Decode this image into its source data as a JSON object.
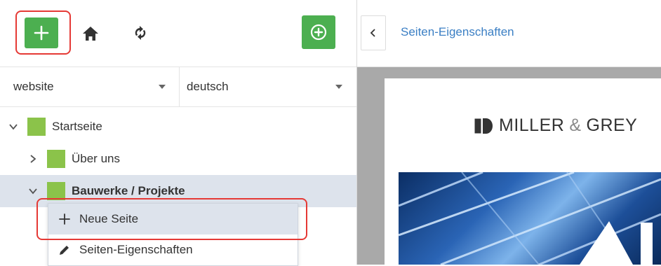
{
  "left_panel": {
    "toolbar": {
      "add_button": {
        "label": "+",
        "icon": "plus-icon"
      },
      "home_icon": "home-icon",
      "refresh_icon": "refresh-icon",
      "add_circle_icon": "plus-circle-icon"
    },
    "selects": {
      "site": "website",
      "language": "deutsch"
    },
    "tree": [
      {
        "label": "Startseite",
        "expanded": true,
        "level": 0
      },
      {
        "label": "Über uns",
        "expanded": false,
        "level": 1
      },
      {
        "label": "Bauwerke / Projekte",
        "expanded": true,
        "level": 1,
        "selected": true
      }
    ],
    "context_menu": [
      {
        "label": "Neue Seite",
        "icon": "plus-icon"
      },
      {
        "label": "Seiten-Eigenschaften",
        "icon": "pencil-icon"
      }
    ]
  },
  "right_panel": {
    "breadcrumb": "Seiten-Eigenschaften",
    "preview": {
      "logo_text_1": "MILLER",
      "logo_text_2": "&",
      "logo_text_3": "GREY"
    }
  },
  "colors": {
    "green": "#4caf50",
    "page_green": "#8bc34a",
    "highlight_red": "#e53935",
    "link_blue": "#3b7fc4",
    "selected_bg": "#dde3ec"
  }
}
